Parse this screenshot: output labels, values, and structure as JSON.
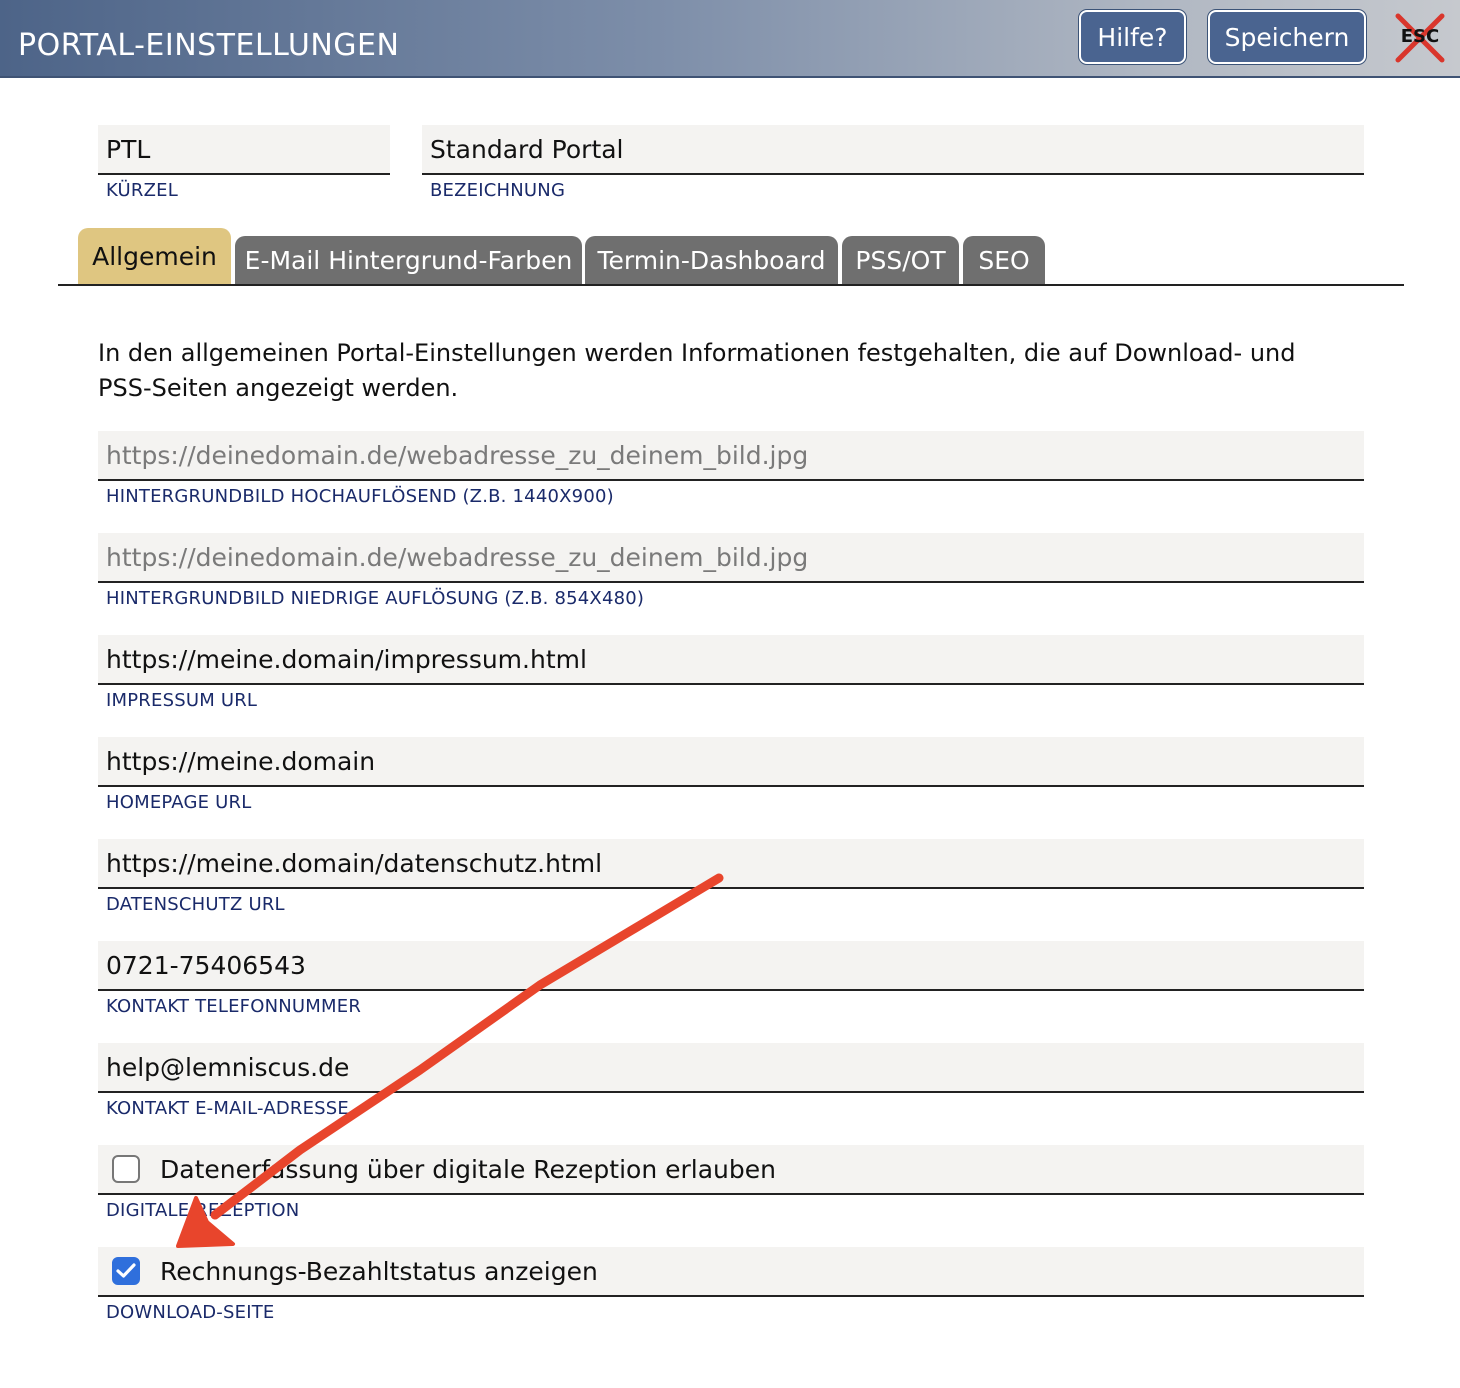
{
  "header": {
    "title": "PORTAL-EINSTELLUNGEN",
    "help_label": "Hilfe?",
    "save_label": "Speichern",
    "esc_label": "ESC"
  },
  "identity": {
    "short_value": "PTL",
    "short_label": "KÜRZEL",
    "name_value": "Standard Portal",
    "name_label": "BEZEICHNUNG"
  },
  "tabs": [
    {
      "label": "Allgemein",
      "active": true
    },
    {
      "label": "E-Mail Hintergrund-Farben",
      "active": false
    },
    {
      "label": "Termin-Dashboard",
      "active": false
    },
    {
      "label": "PSS/OT",
      "active": false
    },
    {
      "label": "SEO",
      "active": false
    }
  ],
  "description": "In den allgemeinen Portal-Einstellungen werden Informationen festgehalten, die auf Download- und PSS-Seiten angezeigt werden.",
  "fields": [
    {
      "placeholder": "https://deinedomain.de/webadresse_zu_deinem_bild.jpg",
      "value": "",
      "label": "HINTERGRUNDBILD HOCHAUFLÖSEND (Z.B. 1440X900)"
    },
    {
      "placeholder": "https://deinedomain.de/webadresse_zu_deinem_bild.jpg",
      "value": "",
      "label": "HINTERGRUNDBILD NIEDRIGE AUFLÖSUNG (Z.B. 854X480)"
    },
    {
      "placeholder": "",
      "value": "https://meine.domain/impressum.html",
      "label": "IMPRESSUM URL"
    },
    {
      "placeholder": "",
      "value": "https://meine.domain",
      "label": "HOMEPAGE URL"
    },
    {
      "placeholder": "",
      "value": "https://meine.domain/datenschutz.html",
      "label": "DATENSCHUTZ URL"
    },
    {
      "placeholder": "",
      "value": "0721-75406543",
      "label": "KONTAKT TELEFONNUMMER"
    },
    {
      "placeholder": "",
      "value": "help@lemniscus.de",
      "label": "KONTAKT E-MAIL-ADRESSE"
    }
  ],
  "checkboxes": [
    {
      "text": "Datenerfassung über digitale Rezeption erlauben",
      "label": "DIGITALE REZEPTION",
      "checked": false
    },
    {
      "text": "Rechnungs-Bezahltstatus anzeigen",
      "label": "DOWNLOAD-SEITE",
      "checked": true
    }
  ],
  "colors": {
    "header_gradient_start": "#4d6488",
    "button_blue": "#4a6490",
    "active_tab": "#dfc681",
    "inactive_tab": "#6f6f6f",
    "label_navy": "#1a2a6a",
    "annotation_arrow": "#e8452c",
    "checkbox_checked": "#2f6fdc"
  },
  "icons": {
    "close": "esc-close-icon",
    "check": "checkmark-icon",
    "annotation": "red-arrow-annotation"
  }
}
